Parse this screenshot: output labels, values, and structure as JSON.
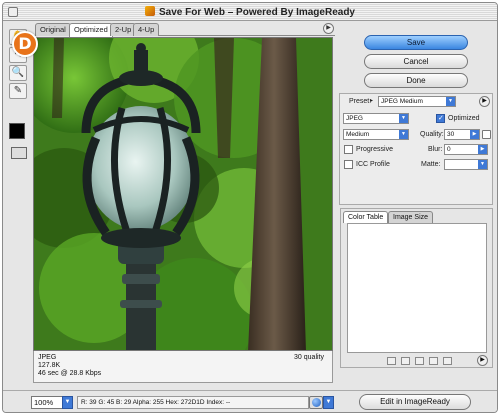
{
  "window": {
    "title": "Save For Web – Powered By ImageReady"
  },
  "badge": {
    "letter": "D"
  },
  "tabs": [
    {
      "label": "Original",
      "active": false
    },
    {
      "label": "Optimized",
      "active": true
    },
    {
      "label": "2-Up",
      "active": false
    },
    {
      "label": "4-Up",
      "active": false
    }
  ],
  "image_info": {
    "format": "JPEG",
    "size": "127.8K",
    "download_time": "46 sec @ 28.8 Kbps",
    "quality": "30 quality"
  },
  "buttons": {
    "save": "Save",
    "cancel": "Cancel",
    "done": "Done",
    "edit": "Edit in ImageReady"
  },
  "settings": {
    "preset_label": "Preset:",
    "preset_value": "JPEG Medium",
    "format_value": "JPEG",
    "optimized_label": "Optimized",
    "optimized_checked": true,
    "quality_preset_value": "Medium",
    "quality_label": "Quality:",
    "quality_value": "30",
    "progressive_label": "Progressive",
    "progressive_checked": false,
    "blur_label": "Blur:",
    "blur_value": "0",
    "icc_label": "ICC Profile",
    "icc_checked": false,
    "matte_label": "Matte:",
    "matte_value": ""
  },
  "panel_tabs": {
    "color_table": "Color Table",
    "image_size": "Image Size"
  },
  "status": {
    "zoom": "100%",
    "readout": "R:   39   G:   45   B:   29   Alpha: 255   Hex:   272D1D   Index:   --"
  },
  "colors": {
    "accent_blue": "#3f79d6",
    "badge_orange": "#e8731a"
  }
}
